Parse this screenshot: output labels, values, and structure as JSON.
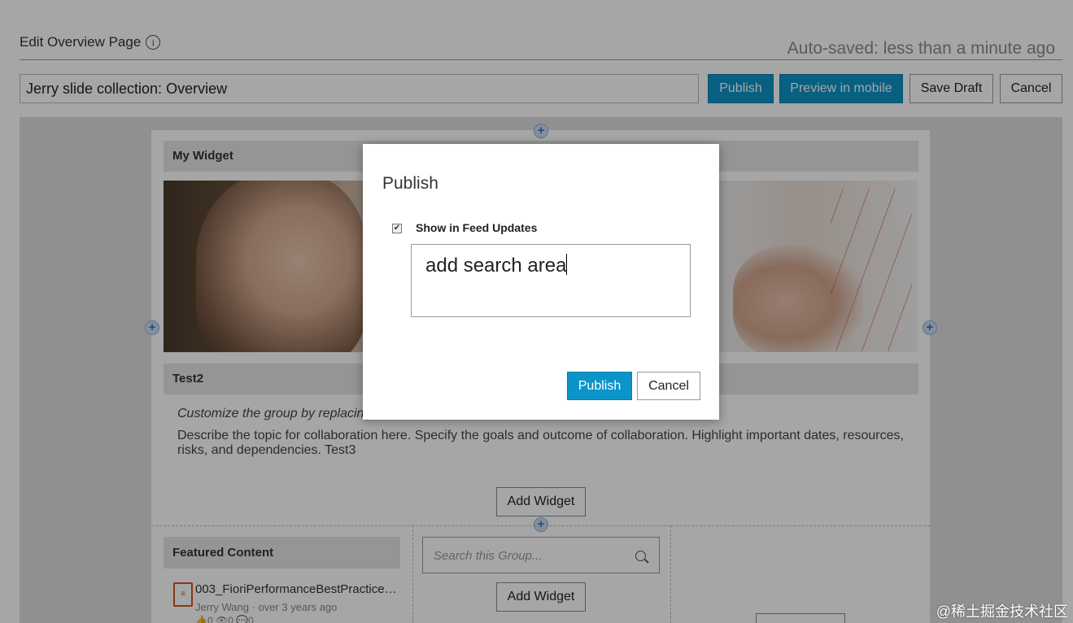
{
  "header": {
    "title": "Edit Overview Page",
    "info_icon": "ⓘ",
    "autosaved": "Auto-saved: less than a minute ago",
    "page_title_value": "Jerry slide collection: Overview"
  },
  "toolbar": {
    "publish_label": "Publish",
    "preview_label": "Preview in mobile",
    "save_draft_label": "Save Draft",
    "cancel_label": "Cancel"
  },
  "widgets": {
    "my_widget_title": "My Widget",
    "test2_title": "Test2",
    "test2_italic": "Customize the group by replacing",
    "test2_description": "Describe the topic for collaboration here. Specify the goals and outcome of collaboration. Highlight important dates, resources, risks, and dependencies. Test3",
    "add_widget_label": "Add Widget",
    "featured_title": "Featured Content",
    "featured_item": {
      "name": "003_FioriPerformanceBestPractice…",
      "meta": "Jerry Wang · over 3 years ago",
      "stats": "👍0 👁0 💬0"
    },
    "search_placeholder": "Search this Group..."
  },
  "dialog": {
    "title": "Publish",
    "checkbox_label": "Show in Feed Updates",
    "checkbox_checked": true,
    "textarea_value": "add search area",
    "publish_label": "Publish",
    "cancel_label": "Cancel"
  },
  "watermark": "@稀土掘金技术社区",
  "colors": {
    "primary": "#0b94c8",
    "overlay": "rgba(0,0,0,0.35)"
  }
}
